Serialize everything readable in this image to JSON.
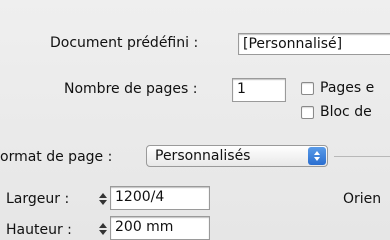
{
  "document_preset": {
    "label": "Document prédéfini :",
    "value": "[Personnalisé]"
  },
  "page_count": {
    "label": "Nombre de pages :",
    "value": "1"
  },
  "facing_pages": {
    "label": "Pages e"
  },
  "master_text_frame": {
    "label": "Bloc de"
  },
  "page_format": {
    "label": "ormat de page :",
    "value": "Personnalisés"
  },
  "width": {
    "label": "Largeur :",
    "value": "1200/4"
  },
  "height": {
    "label": "Hauteur :",
    "value": "200 mm"
  },
  "orientation": {
    "label": "Orien"
  }
}
